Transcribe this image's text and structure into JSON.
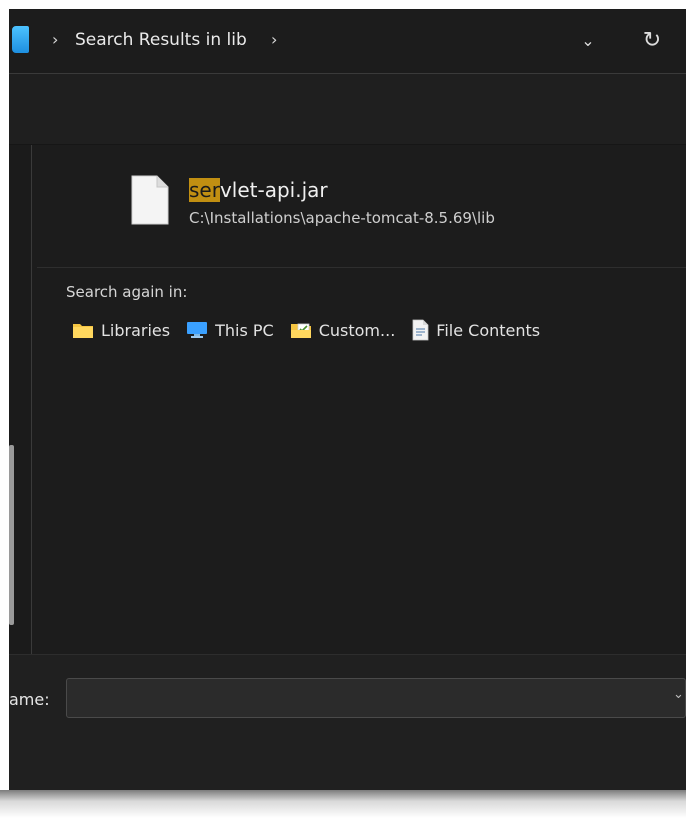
{
  "address_bar": {
    "breadcrumb": "Search Results in lib",
    "separator": "›",
    "dropdown_glyph": "⌄",
    "refresh_glyph": "↻"
  },
  "results": [
    {
      "name_highlight": "ser",
      "name_rest": "vlet-api.jar",
      "path": "C:\\Installations\\apache-tomcat-8.5.69\\lib"
    }
  ],
  "search_again": {
    "label": "Search again in:",
    "targets": [
      {
        "label": "Libraries",
        "icon": "folder-icon"
      },
      {
        "label": "This PC",
        "icon": "pc-icon"
      },
      {
        "label": "Custom...",
        "icon": "custom-folder-icon"
      },
      {
        "label": "File Contents",
        "icon": "document-icon"
      }
    ]
  },
  "footer": {
    "filename_label": "ame:",
    "filename_value": ""
  },
  "colors": {
    "highlight": "#c18f12",
    "background": "#1c1c1c",
    "accent_blue": "#1e8fe0"
  }
}
